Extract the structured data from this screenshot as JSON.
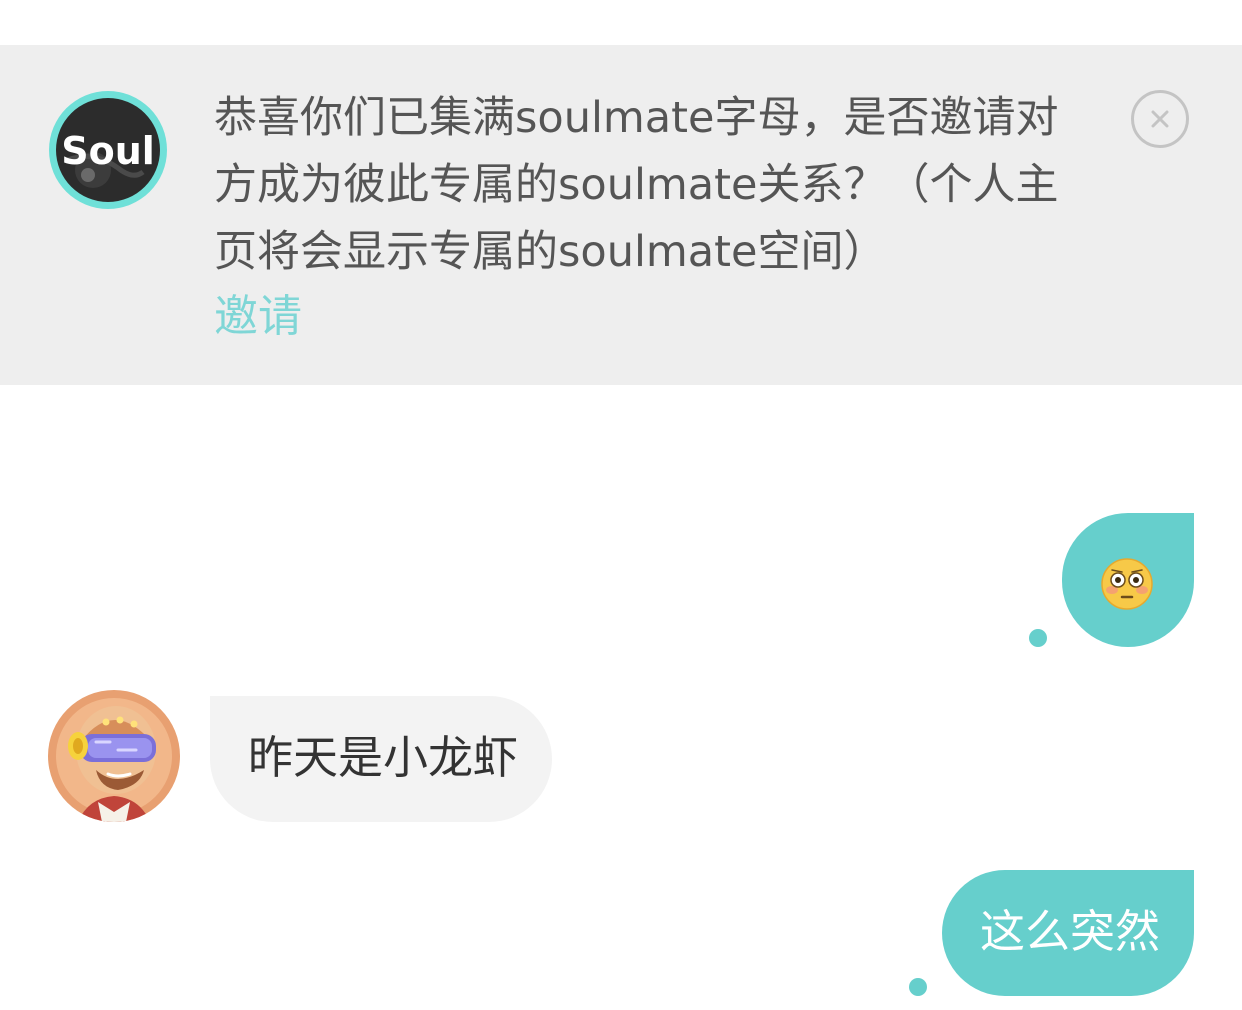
{
  "notice": {
    "logo_text": "Soul",
    "message": "恭喜你们已集满soulmate字母，是否邀请对方成为彼此专属的soulmate关系？（个人主页将会显示专属的soulmate空间）",
    "invite_label": "邀请",
    "close_icon": "close-circle-icon"
  },
  "messages": [
    {
      "sender": "me",
      "type": "emoji",
      "icon": "flushed-face-emoji"
    },
    {
      "sender": "other",
      "type": "text",
      "text": "昨天是小龙虾"
    },
    {
      "sender": "me",
      "type": "text",
      "text": "这么突然"
    }
  ],
  "colors": {
    "accent": "#66cfcc",
    "link": "#7fd6d6",
    "banner_bg": "#eeeeee",
    "incoming_bubble": "#f3f3f3"
  }
}
